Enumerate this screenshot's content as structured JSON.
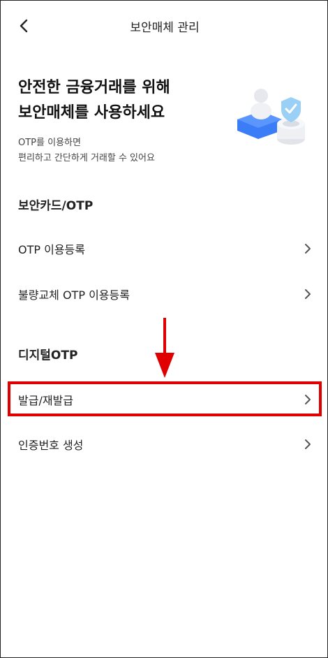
{
  "header": {
    "title": "보안매체 관리"
  },
  "hero": {
    "title_line1": "안전한 금융거래를 위해",
    "title_line2": "보안매체를 사용하세요",
    "sub_line1": "OTP를 이용하면",
    "sub_line2": "편리하고 간단하게 거래할 수 있어요"
  },
  "sections": {
    "security_card": {
      "title": "보안카드/OTP",
      "items": [
        "OTP 이용등록",
        "불량교체 OTP 이용등록"
      ]
    },
    "digital_otp": {
      "title": "디지털OTP",
      "items": [
        "발급/재발급",
        "인증번호 생성"
      ]
    }
  },
  "colors": {
    "highlight": "#e00000",
    "accent_blue": "#2f6df6"
  },
  "icons": [
    "back-arrow-icon",
    "chevron-right-icon",
    "shield-illustration"
  ]
}
